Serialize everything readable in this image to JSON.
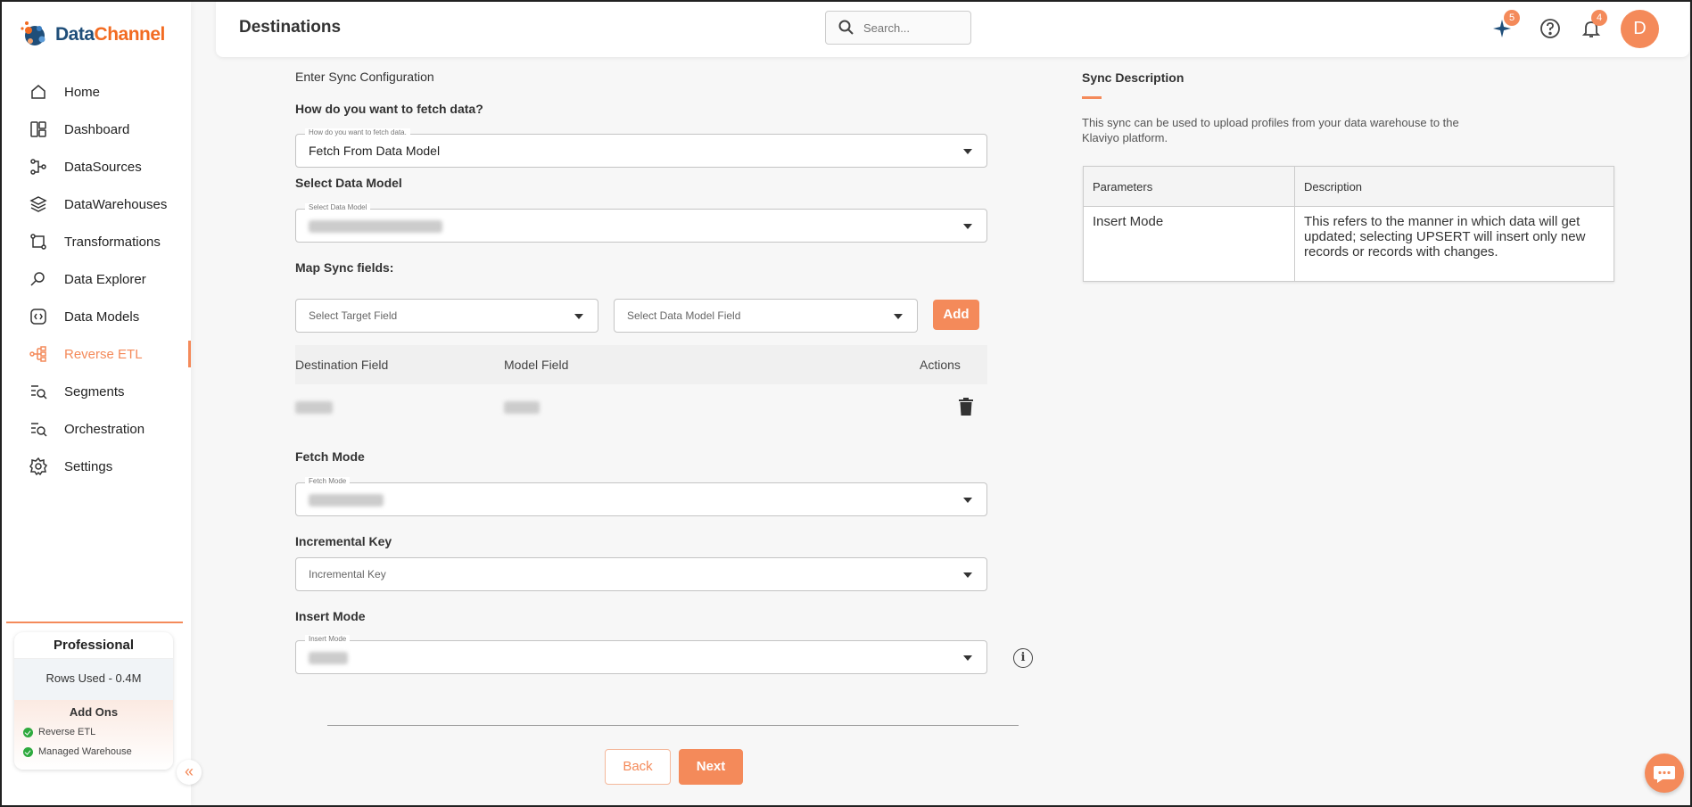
{
  "app": {
    "brand_part1": "Data",
    "brand_part2": "Channel"
  },
  "sidebar": {
    "items": [
      {
        "label": "Home",
        "icon": "home-icon"
      },
      {
        "label": "Dashboard",
        "icon": "dashboard-icon"
      },
      {
        "label": "DataSources",
        "icon": "datasources-icon"
      },
      {
        "label": "DataWarehouses",
        "icon": "datawarehouses-icon"
      },
      {
        "label": "Transformations",
        "icon": "transformations-icon"
      },
      {
        "label": "Data Explorer",
        "icon": "data-explorer-icon"
      },
      {
        "label": "Data Models",
        "icon": "data-models-icon"
      },
      {
        "label": "Reverse ETL",
        "icon": "reverse-etl-icon",
        "active": true
      },
      {
        "label": "Segments",
        "icon": "segments-icon"
      },
      {
        "label": "Orchestration",
        "icon": "orchestration-icon"
      },
      {
        "label": "Settings",
        "icon": "settings-icon"
      }
    ],
    "plan": {
      "title": "Professional",
      "rows_used": "Rows Used - 0.4M",
      "addons_title": "Add Ons",
      "addons": [
        "Reverse ETL",
        "Managed Warehouse"
      ]
    }
  },
  "header": {
    "title": "Destinations",
    "search_placeholder": "Search...",
    "sparkle_badge": "5",
    "notification_badge": "4",
    "avatar_initial": "D"
  },
  "form": {
    "section_title": "Enter Sync Configuration",
    "fetch_question": "How do you want to fetch data?",
    "fetch_float": "How do you want to fetch data.",
    "fetch_value": "Fetch From Data Model",
    "data_model_label": "Select Data Model",
    "data_model_float": "Select Data Model",
    "map_label": "Map Sync fields:",
    "target_field_placeholder": "Select Target Field",
    "model_field_placeholder": "Select Data Model Field",
    "add_label": "Add",
    "table_headers": [
      "Destination Field",
      "Model Field",
      "Actions"
    ],
    "fetch_mode_label": "Fetch Mode",
    "fetch_mode_float": "Fetch Mode",
    "incremental_label": "Incremental Key",
    "incremental_placeholder": "Incremental Key",
    "insert_mode_label": "Insert Mode",
    "insert_mode_float": "Insert Mode",
    "back_label": "Back",
    "next_label": "Next"
  },
  "sync_description": {
    "title": "Sync Description",
    "text": "This sync can be used to upload profiles from your data warehouse to the Klaviyo platform.",
    "table_headers": [
      "Parameters",
      "Description"
    ],
    "rows": [
      {
        "parameter": "Insert Mode",
        "description": "This refers to the manner in which data will get updated; selecting UPSERT will insert only new records or records with changes."
      }
    ]
  },
  "colors": {
    "accent": "#f48a5a",
    "brand_dark": "#1f4e79",
    "brand_orange": "#f26b21"
  }
}
